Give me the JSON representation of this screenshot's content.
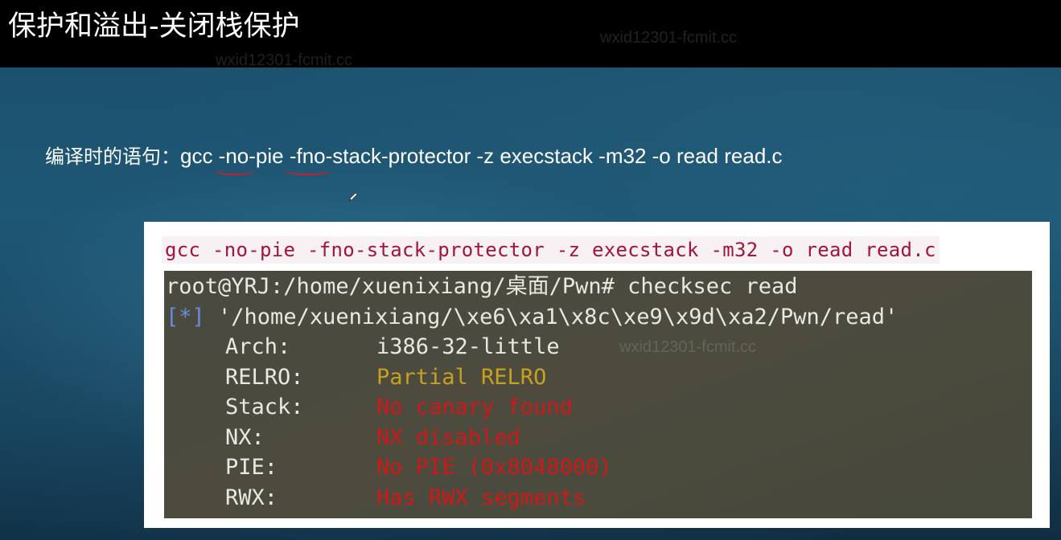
{
  "slide": {
    "title": "保护和溢出-关闭栈保护",
    "subtitle_prefix": "编译时的语句：",
    "subtitle_command": "gcc -no-pie -fno-stack-protector -z execstack -m32 -o read read.c"
  },
  "watermarks": [
    "wxid12301-fcmit.cc",
    "wxid12301-fcmit.cc",
    "wxid12301-fcmit.cc"
  ],
  "screenshot": {
    "top_command": "gcc -no-pie -fno-stack-protector -z execstack -m32 -o read read.c",
    "terminal": {
      "prompt_line": "root@YRJ:/home/xuenixiang/桌面/Pwn# checksec read",
      "status_marker": "[*]",
      "path_line": " '/home/xuenixiang/\\xe6\\xa1\\x8c\\xe9\\x9d\\xa2/Pwn/read'",
      "fields": [
        {
          "label": "Arch:",
          "value": "i386-32-little",
          "color": "#e8e8e4"
        },
        {
          "label": "RELRO:",
          "value": "Partial RELRO",
          "color": "#c8a020"
        },
        {
          "label": "Stack:",
          "value": "No canary found",
          "color": "#d01818"
        },
        {
          "label": "NX:",
          "value": "NX disabled",
          "color": "#d01818"
        },
        {
          "label": "PIE:",
          "value": "No PIE (0x8048000)",
          "color": "#d01818"
        },
        {
          "label": "RWX:",
          "value": "Has RWX segments",
          "color": "#d01818"
        }
      ]
    }
  },
  "colors": {
    "title_bar": "#000000",
    "underline": "#d11a2a",
    "command_text": "#a3143c",
    "terminal_bg": "#4a4a40"
  }
}
